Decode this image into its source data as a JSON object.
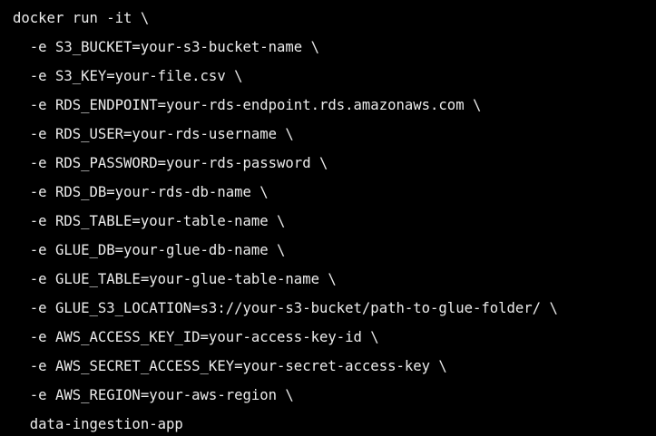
{
  "code": {
    "lines": [
      "docker run -it \\",
      "  -e S3_BUCKET=your-s3-bucket-name \\",
      "  -e S3_KEY=your-file.csv \\",
      "  -e RDS_ENDPOINT=your-rds-endpoint.rds.amazonaws.com \\",
      "  -e RDS_USER=your-rds-username \\",
      "  -e RDS_PASSWORD=your-rds-password \\",
      "  -e RDS_DB=your-rds-db-name \\",
      "  -e RDS_TABLE=your-table-name \\",
      "  -e GLUE_DB=your-glue-db-name \\",
      "  -e GLUE_TABLE=your-glue-table-name \\",
      "  -e GLUE_S3_LOCATION=s3://your-s3-bucket/path-to-glue-folder/ \\",
      "  -e AWS_ACCESS_KEY_ID=your-access-key-id \\",
      "  -e AWS_SECRET_ACCESS_KEY=your-secret-access-key \\",
      "  -e AWS_REGION=your-aws-region \\",
      "  data-ingestion-app"
    ]
  },
  "colors": {
    "background": "#000000",
    "text": "#ececec"
  }
}
